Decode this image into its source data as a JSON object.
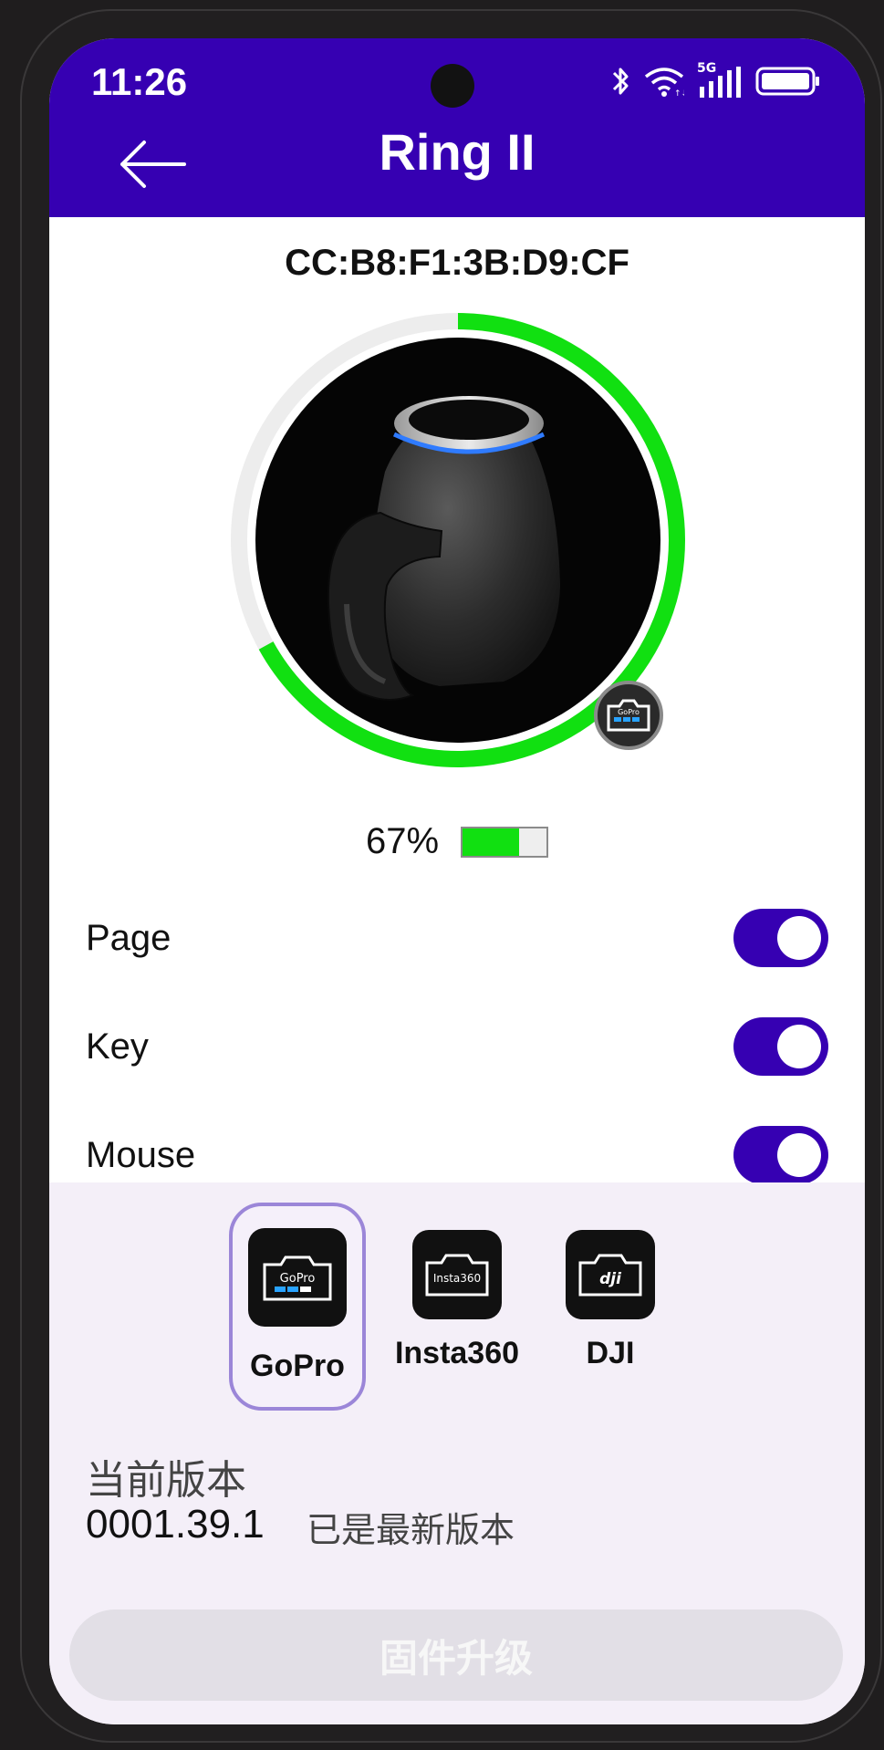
{
  "status_bar": {
    "time": "11:26",
    "network_label": "5G",
    "icons": [
      "bluetooth-icon",
      "wifi-icon",
      "signal-icon",
      "battery-icon"
    ]
  },
  "header": {
    "title": "Ring II",
    "back_icon": "arrow-left-icon"
  },
  "device": {
    "mac": "CC:B8:F1:3B:D9:CF",
    "battery_percent": 67,
    "battery_text": "67%",
    "image": "ring-device-image",
    "badge_label": "GoPro"
  },
  "toggles": [
    {
      "label": "Page",
      "on": true
    },
    {
      "label": "Key",
      "on": true
    },
    {
      "label": "Mouse",
      "on": true
    }
  ],
  "brands": [
    {
      "label": "GoPro",
      "icon_text": "GoPro",
      "selected": true
    },
    {
      "label": "Insta360",
      "icon_text": "Insta360",
      "selected": false
    },
    {
      "label": "DJI",
      "icon_text": "dji",
      "selected": false
    }
  ],
  "firmware": {
    "title": "当前版本",
    "version": "0001.39.1",
    "status": "已是最新版本",
    "upgrade_label": "固件升级"
  },
  "colors": {
    "header": "#3600b2",
    "battery_green": "#11e011",
    "toggle_on": "#3600b2",
    "panel_bg": "#f4eff8"
  }
}
